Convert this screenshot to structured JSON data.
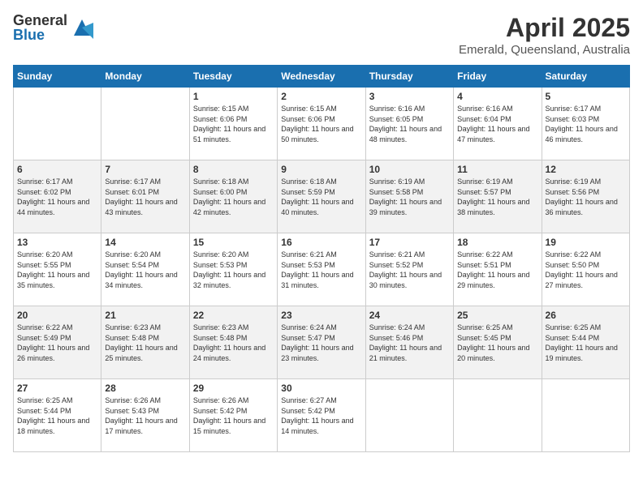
{
  "logo": {
    "general": "General",
    "blue": "Blue"
  },
  "title": "April 2025",
  "location": "Emerald, Queensland, Australia",
  "weekdays": [
    "Sunday",
    "Monday",
    "Tuesday",
    "Wednesday",
    "Thursday",
    "Friday",
    "Saturday"
  ],
  "weeks": [
    [
      {
        "day": "",
        "info": ""
      },
      {
        "day": "",
        "info": ""
      },
      {
        "day": "1",
        "info": "Sunrise: 6:15 AM\nSunset: 6:06 PM\nDaylight: 11 hours and 51 minutes."
      },
      {
        "day": "2",
        "info": "Sunrise: 6:15 AM\nSunset: 6:06 PM\nDaylight: 11 hours and 50 minutes."
      },
      {
        "day": "3",
        "info": "Sunrise: 6:16 AM\nSunset: 6:05 PM\nDaylight: 11 hours and 48 minutes."
      },
      {
        "day": "4",
        "info": "Sunrise: 6:16 AM\nSunset: 6:04 PM\nDaylight: 11 hours and 47 minutes."
      },
      {
        "day": "5",
        "info": "Sunrise: 6:17 AM\nSunset: 6:03 PM\nDaylight: 11 hours and 46 minutes."
      }
    ],
    [
      {
        "day": "6",
        "info": "Sunrise: 6:17 AM\nSunset: 6:02 PM\nDaylight: 11 hours and 44 minutes."
      },
      {
        "day": "7",
        "info": "Sunrise: 6:17 AM\nSunset: 6:01 PM\nDaylight: 11 hours and 43 minutes."
      },
      {
        "day": "8",
        "info": "Sunrise: 6:18 AM\nSunset: 6:00 PM\nDaylight: 11 hours and 42 minutes."
      },
      {
        "day": "9",
        "info": "Sunrise: 6:18 AM\nSunset: 5:59 PM\nDaylight: 11 hours and 40 minutes."
      },
      {
        "day": "10",
        "info": "Sunrise: 6:19 AM\nSunset: 5:58 PM\nDaylight: 11 hours and 39 minutes."
      },
      {
        "day": "11",
        "info": "Sunrise: 6:19 AM\nSunset: 5:57 PM\nDaylight: 11 hours and 38 minutes."
      },
      {
        "day": "12",
        "info": "Sunrise: 6:19 AM\nSunset: 5:56 PM\nDaylight: 11 hours and 36 minutes."
      }
    ],
    [
      {
        "day": "13",
        "info": "Sunrise: 6:20 AM\nSunset: 5:55 PM\nDaylight: 11 hours and 35 minutes."
      },
      {
        "day": "14",
        "info": "Sunrise: 6:20 AM\nSunset: 5:54 PM\nDaylight: 11 hours and 34 minutes."
      },
      {
        "day": "15",
        "info": "Sunrise: 6:20 AM\nSunset: 5:53 PM\nDaylight: 11 hours and 32 minutes."
      },
      {
        "day": "16",
        "info": "Sunrise: 6:21 AM\nSunset: 5:53 PM\nDaylight: 11 hours and 31 minutes."
      },
      {
        "day": "17",
        "info": "Sunrise: 6:21 AM\nSunset: 5:52 PM\nDaylight: 11 hours and 30 minutes."
      },
      {
        "day": "18",
        "info": "Sunrise: 6:22 AM\nSunset: 5:51 PM\nDaylight: 11 hours and 29 minutes."
      },
      {
        "day": "19",
        "info": "Sunrise: 6:22 AM\nSunset: 5:50 PM\nDaylight: 11 hours and 27 minutes."
      }
    ],
    [
      {
        "day": "20",
        "info": "Sunrise: 6:22 AM\nSunset: 5:49 PM\nDaylight: 11 hours and 26 minutes."
      },
      {
        "day": "21",
        "info": "Sunrise: 6:23 AM\nSunset: 5:48 PM\nDaylight: 11 hours and 25 minutes."
      },
      {
        "day": "22",
        "info": "Sunrise: 6:23 AM\nSunset: 5:48 PM\nDaylight: 11 hours and 24 minutes."
      },
      {
        "day": "23",
        "info": "Sunrise: 6:24 AM\nSunset: 5:47 PM\nDaylight: 11 hours and 23 minutes."
      },
      {
        "day": "24",
        "info": "Sunrise: 6:24 AM\nSunset: 5:46 PM\nDaylight: 11 hours and 21 minutes."
      },
      {
        "day": "25",
        "info": "Sunrise: 6:25 AM\nSunset: 5:45 PM\nDaylight: 11 hours and 20 minutes."
      },
      {
        "day": "26",
        "info": "Sunrise: 6:25 AM\nSunset: 5:44 PM\nDaylight: 11 hours and 19 minutes."
      }
    ],
    [
      {
        "day": "27",
        "info": "Sunrise: 6:25 AM\nSunset: 5:44 PM\nDaylight: 11 hours and 18 minutes."
      },
      {
        "day": "28",
        "info": "Sunrise: 6:26 AM\nSunset: 5:43 PM\nDaylight: 11 hours and 17 minutes."
      },
      {
        "day": "29",
        "info": "Sunrise: 6:26 AM\nSunset: 5:42 PM\nDaylight: 11 hours and 15 minutes."
      },
      {
        "day": "30",
        "info": "Sunrise: 6:27 AM\nSunset: 5:42 PM\nDaylight: 11 hours and 14 minutes."
      },
      {
        "day": "",
        "info": ""
      },
      {
        "day": "",
        "info": ""
      },
      {
        "day": "",
        "info": ""
      }
    ]
  ]
}
